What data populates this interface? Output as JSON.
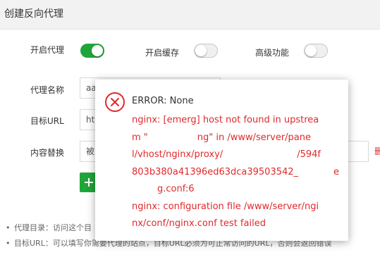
{
  "window": {
    "title": "创建反向代理"
  },
  "form": {
    "proxy_toggle_label": "开启代理",
    "cache_toggle_label": "开启缓存",
    "advanced_toggle_label": "高级功能",
    "proxy_enabled": true,
    "cache_enabled": false,
    "advanced_enabled": false,
    "name_label": "代理名称",
    "name_value": "aa",
    "target_label": "目标URL",
    "target_value": "ht",
    "replace_label": "内容替换",
    "replace_value": "被",
    "right_mark": "删"
  },
  "notes": [
    "代理目录：访问这个目",
    "目标URL：可以填写你需要代理的站点，目标URL必须为可正常访问的URL，否则会返回错误"
  ],
  "modal": {
    "icon": "error-circle-x-icon",
    "heading": "ERROR: None",
    "message_lines": [
      "nginx: [emerg] host not found in upstrea",
      "m \"",
      "l/vhost/nginx/proxy/",
      "803b380a41396ed63dca39503542_",
      "g.conf:6",
      "nginx: configuration file /www/server/ngi",
      "nx/conf/nginx.conf test failed"
    ],
    "line2_tail": "ng\" in /www/server/pane",
    "line3_tail": "/594f",
    "line4_tail": "e",
    "colors": {
      "error": "#e0292b",
      "accent": "#20a53a"
    }
  }
}
